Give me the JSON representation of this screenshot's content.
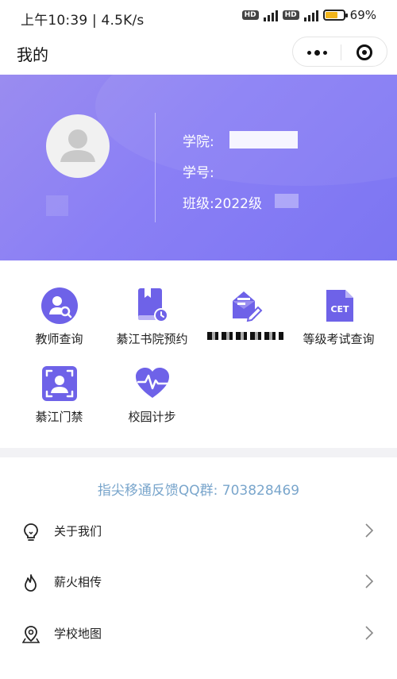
{
  "status_bar": {
    "time": "上午10:39 | 4.5K/s",
    "network": "4G",
    "hd": "HD",
    "battery_percent": 69,
    "battery_text": "69%"
  },
  "title_bar": {
    "title": "我的"
  },
  "profile": {
    "college_label": "学院:",
    "student_id_label": "学号:",
    "class_label": "班级:",
    "class_value": "2022级"
  },
  "services": [
    {
      "label": "教师查询",
      "icon": "teacher-search-icon"
    },
    {
      "label": "綦江书院预约",
      "icon": "book-clock-icon"
    },
    {
      "label": "",
      "icon": "edit-note-icon"
    },
    {
      "label": "等级考试查询",
      "icon": "cet-document-icon"
    },
    {
      "label": "綦江门禁",
      "icon": "access-control-icon"
    },
    {
      "label": "校园计步",
      "icon": "heart-pulse-icon"
    }
  ],
  "feedback_text": "指尖移通反馈QQ群: 703828469",
  "menu": [
    {
      "label": "关于我们",
      "icon": "lightbulb-icon"
    },
    {
      "label": "薪火相传",
      "icon": "flame-icon"
    },
    {
      "label": "学校地图",
      "icon": "map-pin-icon"
    }
  ],
  "colors": {
    "header_start": "#9a8cf0",
    "header_end": "#7c75f2",
    "accent": "#6e62e8",
    "feedback": "#7aa6cc"
  }
}
